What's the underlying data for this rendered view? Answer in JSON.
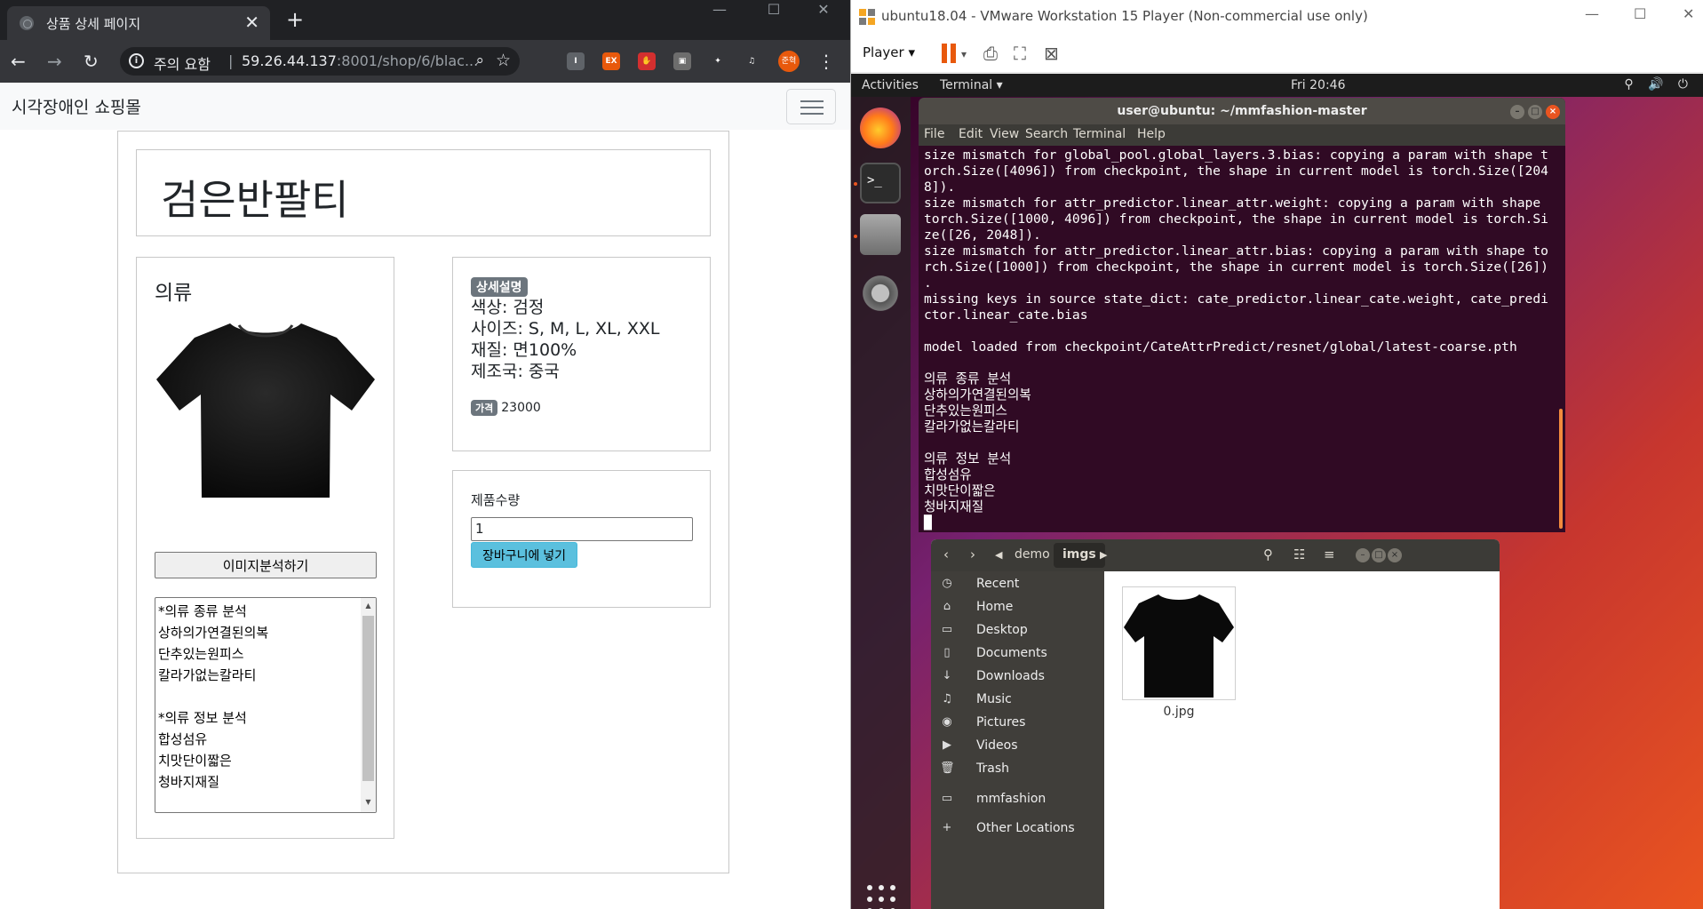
{
  "browser": {
    "tab_title": "상품 상세 페이지",
    "tab_close": "✕",
    "new_tab": "+",
    "win_min": "—",
    "win_max": "☐",
    "win_close": "✕",
    "security_label": "주의 요함",
    "separator": "|",
    "url_host": "59.26.44.137",
    "url_rest": ":8001/shop/6/blac...",
    "extensions": [
      {
        "name": "ext-i",
        "label": "I",
        "color": "#5f6368"
      },
      {
        "name": "ext-ex",
        "label": "EX",
        "color": "#e8590c"
      },
      {
        "name": "ext-hand",
        "label": "✋",
        "color": "#d32f2f"
      },
      {
        "name": "ext-cast",
        "label": "▣",
        "color": "#6d6d6d"
      },
      {
        "name": "ext-puzzle",
        "label": "✦",
        "color": "#35363a"
      },
      {
        "name": "ext-media",
        "label": "♫",
        "color": "#35363a"
      }
    ],
    "avatar_text": "준혁"
  },
  "page": {
    "brand": "시각장애인 쇼핑몰",
    "product_title": "검은반팔티",
    "image_category": "의류",
    "analyze_button": "이미지분석하기",
    "analysis_result": "*의류 종류 분석\n상하의가연결된의복\n단추있는원피스\n칼라가없는칼라티\n\n*의류 정보 분석\n합성섬유\n치맛단이짧은\n청바지재질",
    "detail_badge": "상세설명",
    "details": [
      {
        "label": "색상: ",
        "value": "검정"
      },
      {
        "label": "사이즈: ",
        "value": "S, M, L, XL, XXL"
      },
      {
        "label": "재질: ",
        "value": "면100%"
      },
      {
        "label": "제조국: ",
        "value": "중국"
      }
    ],
    "price_badge": "가격",
    "price": "23000",
    "qty_label": "제품수량",
    "qty_value": "1",
    "cart_button": "장바구니에 넣기"
  },
  "vmware": {
    "title": "ubuntu18.04 - VMware Workstation 15 Player (Non-commercial use only)",
    "player_menu": "Player ▾",
    "ctl_min": "—",
    "ctl_max": "☐",
    "ctl_close": "✕"
  },
  "ubuntu": {
    "activities": "Activities",
    "app_menu": "Terminal ▾",
    "clock": "Fri 20:46",
    "tray": "⚲ 🔊 ⏻"
  },
  "terminal": {
    "title": "user@ubuntu: ~/mmfashion-master",
    "menu": [
      "File",
      "Edit",
      "View",
      "Search",
      "Terminal",
      "Help"
    ],
    "lines": [
      "size mismatch for global_pool.global_layers.3.bias: copying a param with shape t",
      "orch.Size([4096]) from checkpoint, the shape in current model is torch.Size([204",
      "8]).",
      "size mismatch for attr_predictor.linear_attr.weight: copying a param with shape",
      "torch.Size([1000, 4096]) from checkpoint, the shape in current model is torch.Si",
      "ze([26, 2048]).",
      "size mismatch for attr_predictor.linear_attr.bias: copying a param with shape to",
      "rch.Size([1000]) from checkpoint, the shape in current model is torch.Size([26])",
      ".",
      "missing keys in source state_dict: cate_predictor.linear_cate.weight, cate_predi",
      "ctor.linear_cate.bias",
      "",
      "model loaded from checkpoint/CateAttrPredict/resnet/global/latest-coarse.pth",
      "",
      "의류 종류 분석",
      "상하의가연결된의복",
      "단추있는원피스",
      "칼라가없는칼라티",
      "",
      "의류 정보 분석",
      "합성섬유",
      "치맛단이짧은",
      "청바지재질",
      "█"
    ]
  },
  "files": {
    "path": [
      "demo",
      "imgs"
    ],
    "sidebar": [
      {
        "icon": "◷",
        "label": "Recent"
      },
      {
        "icon": "⌂",
        "label": "Home"
      },
      {
        "icon": "▭",
        "label": "Desktop"
      },
      {
        "icon": "▯",
        "label": "Documents"
      },
      {
        "icon": "↓",
        "label": "Downloads"
      },
      {
        "icon": "♫",
        "label": "Music"
      },
      {
        "icon": "◉",
        "label": "Pictures"
      },
      {
        "icon": "▶",
        "label": "Videos"
      },
      {
        "icon": "🗑",
        "label": "Trash"
      },
      {
        "icon": "▭",
        "label": "mmfashion"
      },
      {
        "icon": "+",
        "label": "Other Locations"
      }
    ],
    "file_name": "0.jpg"
  }
}
